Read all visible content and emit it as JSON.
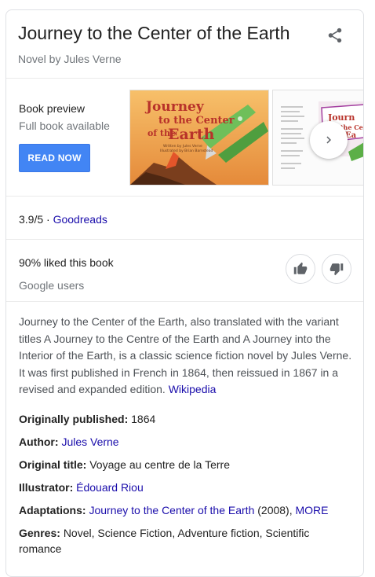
{
  "header": {
    "title": "Journey to the Center of the Earth",
    "subtitle": "Novel by Jules Verne"
  },
  "preview": {
    "label": "Book preview",
    "availability": "Full book available",
    "button": "READ NOW",
    "cover_title_lines": [
      "Journey",
      "to the Center",
      "of the",
      "Earth"
    ],
    "cover_credit_lines": [
      "Written by Jules Verne",
      "Illustrated by Brian Barnstead"
    ]
  },
  "rating": {
    "score": "3.9/5",
    "separator": " · ",
    "source": "Goodreads"
  },
  "liked": {
    "text": "90% liked this book",
    "source": "Google users"
  },
  "description": {
    "text": "Journey to the Center of the Earth, also translated with the variant titles A Journey to the Centre of the Earth and A Journey into the Interior of the Earth, is a classic science fiction novel by Jules Verne. It was first published in French in 1864, then reissued in 1867 in a revised and expanded edition. ",
    "link": "Wikipedia"
  },
  "facts": {
    "published": {
      "label": "Originally published:",
      "value": "1864"
    },
    "author": {
      "label": "Author:",
      "value": "Jules Verne"
    },
    "original_title": {
      "label": "Original title:",
      "value": "Voyage au centre de la Terre"
    },
    "illustrator": {
      "label": "Illustrator:",
      "value": "Édouard Riou"
    },
    "adaptations": {
      "label": "Adaptations:",
      "link": "Journey to the Center of the Earth",
      "year": "(2008),",
      "more": "MORE"
    },
    "genres": {
      "label": "Genres:",
      "value": "Novel, Science Fiction, Adventure fiction, Scientific romance"
    }
  },
  "icons": {
    "share": "share-icon",
    "next": "chevron-right-icon",
    "thumbs_up": "thumbs-up-icon",
    "thumbs_down": "thumbs-down-icon"
  },
  "colors": {
    "accent": "#4285f4",
    "link": "#1a0dab",
    "cover_orange": "#f6a94d",
    "cover_title_red": "#c0392b"
  }
}
